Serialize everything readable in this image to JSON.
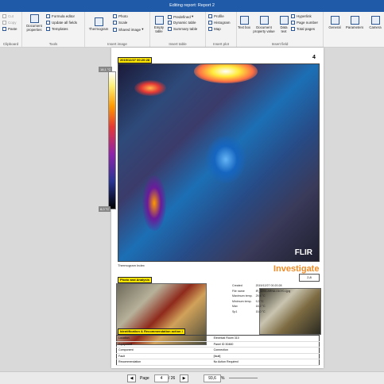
{
  "window": {
    "title": "Editing report: Report 2"
  },
  "ribbon": {
    "clipboard": {
      "title": "Clipboard",
      "cut": "Cut",
      "copy": "Copy",
      "paste": "Paste"
    },
    "tools": {
      "title": "Tools",
      "doc_props": "Document properties",
      "formula": "Formula editor",
      "update": "Update all fields",
      "templates": "Templates"
    },
    "insert_image": {
      "title": "Insert image",
      "thermogram": "Thermogram",
      "photo": "Photo",
      "scale": "Scale",
      "shared": "Shared image"
    },
    "insert_table": {
      "title": "Insert table",
      "empty": "Empty table",
      "predefined": "Predefined",
      "dynamic": "Dynamic table",
      "summary": "Summary table"
    },
    "insert_plot": {
      "title": "Insert plot",
      "profile": "Profile",
      "histogram": "Histogram",
      "map": "Map"
    },
    "insert_field": {
      "title": "Insert field",
      "textbox": "Text box",
      "docprop": "Document property value",
      "datatext": "Data text",
      "hyperlink": "Hyperlink",
      "pagenumber": "Page number",
      "totalpages": "Total pages"
    },
    "right": {
      "general": "General",
      "parameters": "Parameters",
      "camera": "Camera"
    }
  },
  "report": {
    "page_number": "4",
    "thermogram_label": "2015/12/27 00:20:28",
    "scale_top": "18,1 °C",
    "scale_bottom": "8,0 °C",
    "flir_logo": "FLIR",
    "caption": "Thermogram Index",
    "investigate": "Investigate",
    "box_value": "2,8",
    "photo_label": "Photo and Analysis",
    "info_rows": [
      {
        "k": "Created",
        "v": "2015/12/27 00:20:28"
      },
      {
        "k": "File name",
        "v": "IR_4200-ARNA-01070-i.jpg"
      },
      {
        "k": "Maximum temp.",
        "v": "29,4 °C"
      },
      {
        "k": "Minimum temp.",
        "v": "9,3 °C"
      },
      {
        "k": "Max",
        "v": "18,2 °C"
      },
      {
        "k": "Sp1",
        "v": "15,0 °C"
      }
    ],
    "ident_label": "Identification & Recommendation action i",
    "ident_rows": [
      {
        "k": "Location",
        "v": "Electrical Room 310"
      },
      {
        "k": "Equipment",
        "v": "Panel ID 30460"
      },
      {
        "k": "Component",
        "v": "Connection"
      },
      {
        "k": "Fault",
        "v": "[fault]"
      },
      {
        "k": "Recommendation",
        "v": "No Action Required"
      }
    ]
  },
  "statusbar": {
    "page_label": "Page",
    "page_value": "4",
    "of_label": "/ 26",
    "zoom_value": "93,6",
    "zoom_unit": "%"
  }
}
